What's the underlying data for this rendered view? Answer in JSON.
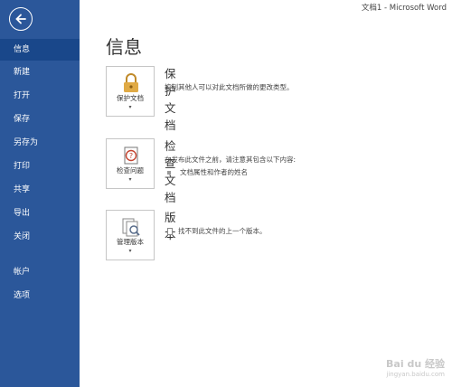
{
  "window": {
    "title": "文档1 - Microsoft Word"
  },
  "sidebar": {
    "items": [
      {
        "label": "信息",
        "active": true
      },
      {
        "label": "新建"
      },
      {
        "label": "打开"
      },
      {
        "label": "保存"
      },
      {
        "label": "另存为"
      },
      {
        "label": "打印"
      },
      {
        "label": "共享"
      },
      {
        "label": "导出"
      },
      {
        "label": "关闭"
      },
      {
        "label": "帐户"
      },
      {
        "label": "选项"
      }
    ]
  },
  "main": {
    "title": "信息",
    "sections": [
      {
        "tile_label": "保护文档",
        "heading": "保护文档",
        "description": "控制其他人可以对此文档所做的更改类型。",
        "icon": "lock-icon"
      },
      {
        "tile_label": "检查问题",
        "heading": "检查文档",
        "description": "在发布此文件之前，请注意其包含以下内容:",
        "bullet": "文档属性和作者的姓名",
        "icon": "inspect-document-icon"
      },
      {
        "tile_label": "管理版本",
        "heading": "版本",
        "description": "找不到此文件的上一个版本。",
        "icon": "manage-versions-icon"
      }
    ],
    "caret": "▾"
  },
  "watermark": {
    "brand": "Bai du 经验",
    "url": "jingyan.baidu.com"
  },
  "colors": {
    "sidebar": "#2b579a",
    "sidebar_active": "#19478a",
    "lock": "#d9a13a"
  }
}
